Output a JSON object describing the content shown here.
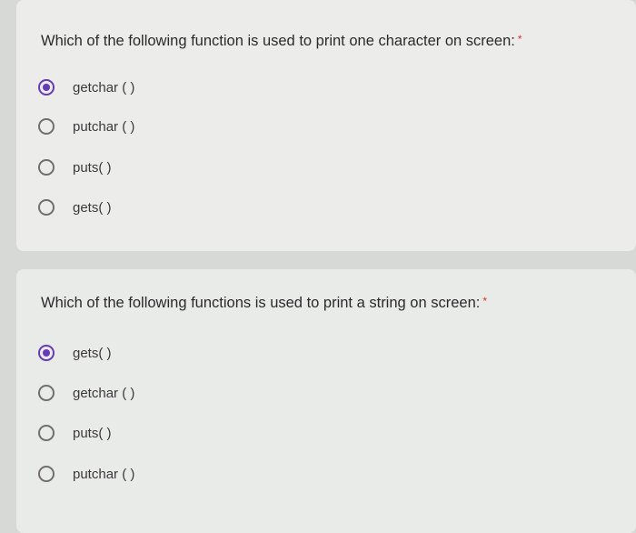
{
  "questions": [
    {
      "text": "Which of the following function is used to print one character on screen:",
      "required_mark": "*",
      "options": [
        {
          "label": "getchar ( )",
          "selected": true
        },
        {
          "label": "putchar ( )",
          "selected": false
        },
        {
          "label": "puts( )",
          "selected": false
        },
        {
          "label": "gets( )",
          "selected": false
        }
      ]
    },
    {
      "text": "Which of the following functions is used to print a string on screen:",
      "required_mark": "*",
      "options": [
        {
          "label": "gets( )",
          "selected": true
        },
        {
          "label": "getchar ( )",
          "selected": false
        },
        {
          "label": "puts( )",
          "selected": false
        },
        {
          "label": "putchar ( )",
          "selected": false
        }
      ]
    }
  ],
  "colors": {
    "accent": "#673ab7",
    "required": "#d93025"
  }
}
